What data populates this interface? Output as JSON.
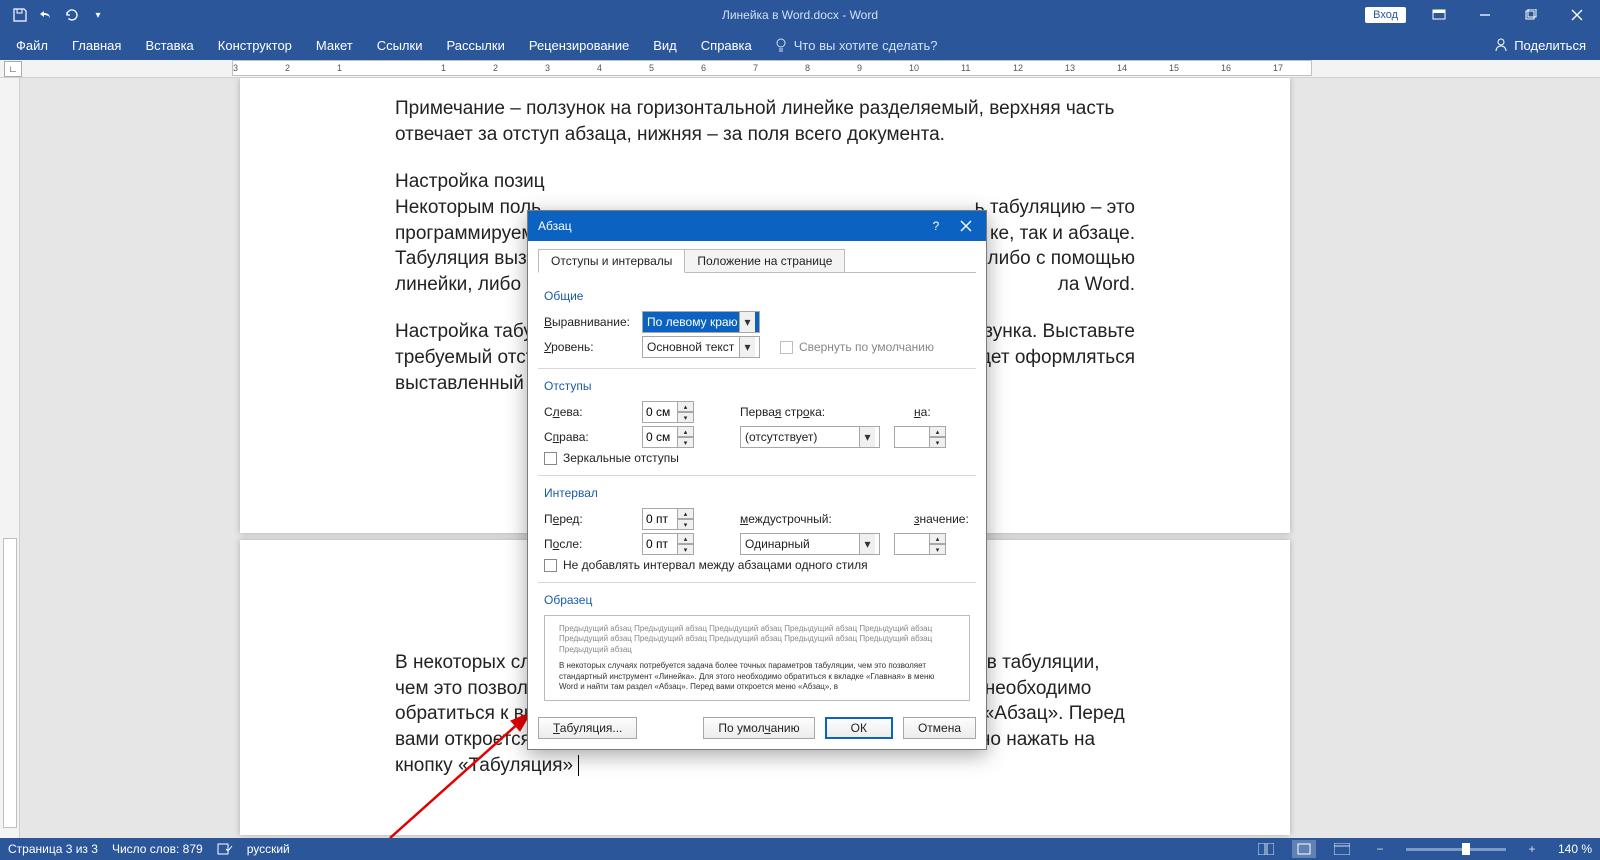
{
  "titlebar": {
    "doc_title": "Линейка в Word.docx - Word",
    "sign_in": "Вход"
  },
  "ribbon": {
    "tabs": [
      "Файл",
      "Главная",
      "Вставка",
      "Конструктор",
      "Макет",
      "Ссылки",
      "Рассылки",
      "Рецензирование",
      "Вид",
      "Справка"
    ],
    "tell_me": "Что вы хотите сделать?",
    "share": "Поделиться"
  },
  "ruler": {
    "numbers": [
      "3",
      "2",
      "1",
      "",
      "1",
      "2",
      "3",
      "4",
      "5",
      "6",
      "7",
      "8",
      "9",
      "10",
      "11",
      "12",
      "13",
      "14",
      "15",
      "16",
      "17"
    ]
  },
  "doc": {
    "p1": "Примечание – ползунок на горизонтальной линейке разделяемый, верхняя часть отвечает за отступ абзаца, нижняя – за поля всего документа.",
    "p2a": "Настройка позиц",
    "p2b": "Некоторым поль",
    "p2c": "программируемы",
    "p2d": "Табуляция вызыв",
    "p2e": "линейки, либо че",
    "p2r1": "ь табуляцию – это",
    "p2r2": "ке, так и абзаце.",
    "p2r3": "отся либо с помощью",
    "p2r4": "ла Word.",
    "p3a": "Настройка табул",
    "p3b": "требуемый отсту",
    "p3c": "выставленный от",
    "p3r1": "о ползунка. Выставьте",
    "p3r2": "удет оформляться",
    "p4": "В некоторых случаях потребуется задача более точных параметров табуляции, чем это позволяет стандартный инструмент «Линейка». Для этого необходимо обратиться к вкладке «Главная» в меню Word и найти там раздел «Абзац». Перед вами откроется меню «Абзац», в левом нижнем углу которого нужно нажать на кнопку «Табуляция»"
  },
  "dialog": {
    "title": "Абзац",
    "tab_indents": "Отступы и интервалы",
    "tab_position": "Положение на странице",
    "grp_general": "Общие",
    "lbl_align": "Выравнивание:",
    "val_align": "По левому краю",
    "lbl_level": "Уровень:",
    "val_level": "Основной текст",
    "chk_collapse": "Свернуть по умолчанию",
    "grp_indent": "Отступы",
    "lbl_left": "Слева:",
    "val_left": "0 см",
    "lbl_right": "Справа:",
    "val_right": "0 см",
    "lbl_firstline": "Первая строка:",
    "val_firstline": "(отсутствует)",
    "lbl_by1": "на:",
    "chk_mirror": "Зеркальные отступы",
    "grp_spacing": "Интервал",
    "lbl_before": "Перед:",
    "val_before": "0 пт",
    "lbl_after": "После:",
    "val_after": "0 пт",
    "lbl_linesp": "междустрочный:",
    "val_linesp": "Одинарный",
    "lbl_by2": "значение:",
    "chk_nospace": "Не добавлять интервал между абзацами одного стиля",
    "grp_preview": "Образец",
    "preview_prev": "Предыдущий абзац Предыдущий абзац Предыдущий абзац Предыдущий абзац Предыдущий абзац Предыдущий абзац Предыдущий абзац Предыдущий абзац Предыдущий абзац Предыдущий абзац Предыдущий абзац",
    "preview_cur": "В некоторых случаях потребуется задача более точных параметров табуляции, чем это позволяет стандартный инструмент «Линейка». Для этого необходимо обратиться к вкладке «Главная» в меню Word и найти там раздел «Абзац». Перед вами откроется меню «Абзац», в",
    "btn_tabs": "Табуляция...",
    "btn_default": "По умолчанию",
    "btn_ok": "ОК",
    "btn_cancel": "Отмена"
  },
  "status": {
    "page": "Страница 3 из 3",
    "words": "Число слов: 879",
    "lang": "русский",
    "zoom": "140 %"
  }
}
